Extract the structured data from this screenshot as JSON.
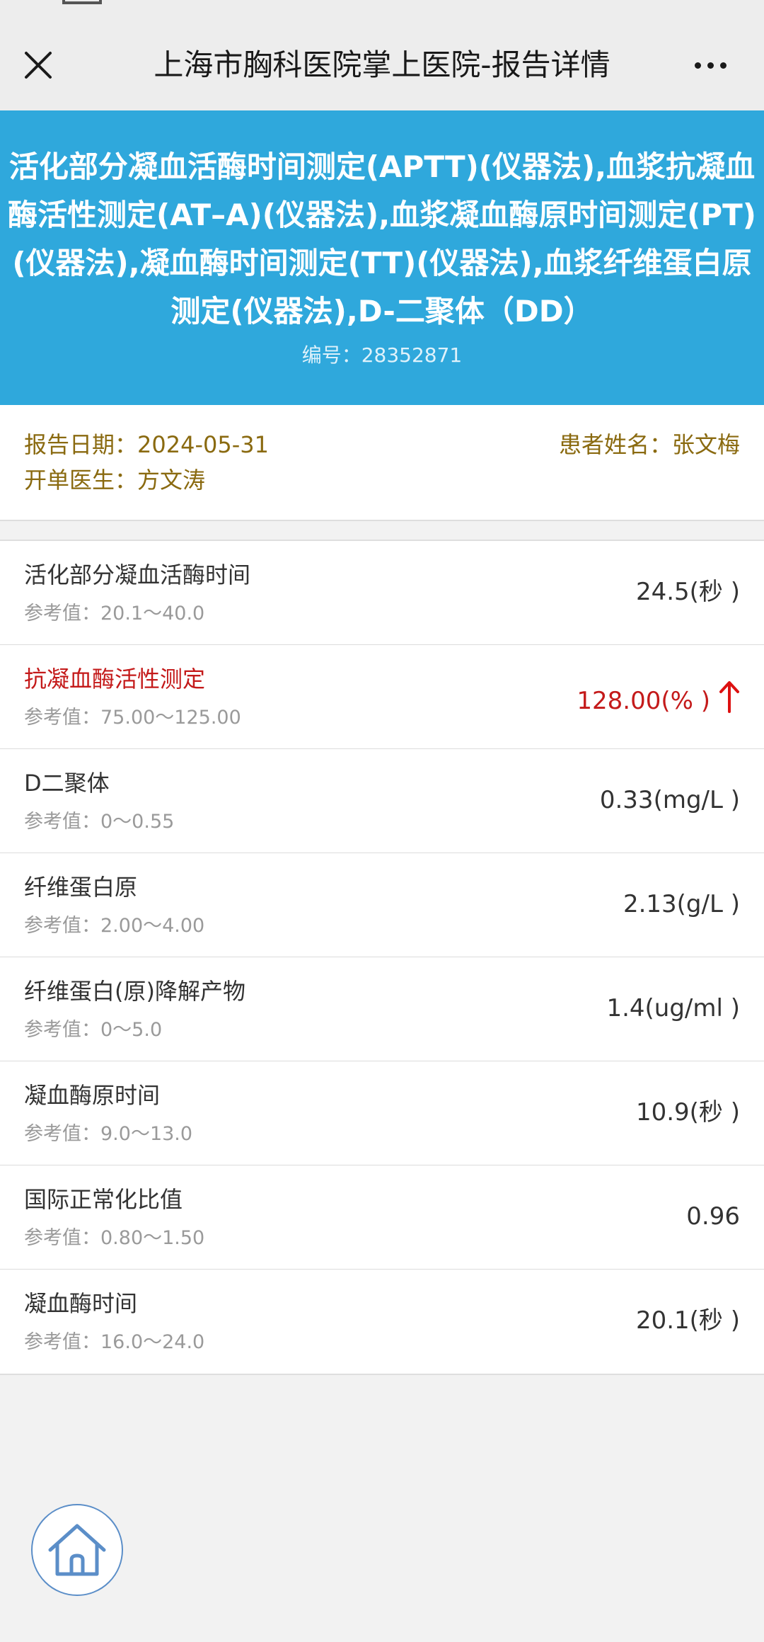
{
  "nav": {
    "title": "上海市胸科医院掌上医院-报告详情",
    "close_icon": "close-icon",
    "more_icon": "more-icon"
  },
  "banner": {
    "title": "活化部分凝血活酶时间测定(APTT)(仪器法),血浆抗凝血酶活性测定(AT–A)(仪器法),血浆凝血酶原时间测定(PT)(仪器法),凝血酶时间测定(TT)(仪器法),血浆纤维蛋白原测定(仪器法),D-二聚体（DD）",
    "serial": "编号：28352871"
  },
  "info": {
    "report_date": "报告日期：2024-05-31",
    "patient_name": "患者姓名：张文梅",
    "doctor": "开单医生：方文涛"
  },
  "results": [
    {
      "name": "活化部分凝血活酶时间",
      "ref": "参考值：20.1～40.0",
      "value": "24.5(秒 )",
      "abnormal": false
    },
    {
      "name": "抗凝血酶活性测定",
      "ref": "参考值：75.00～125.00",
      "value": "128.00(% )",
      "abnormal": true,
      "flag": "high",
      "flag_icon": "up-arrow-icon"
    },
    {
      "name": "D二聚体",
      "ref": "参考值：0～0.55",
      "value": "0.33(mg/L )",
      "abnormal": false
    },
    {
      "name": "纤维蛋白原",
      "ref": "参考值：2.00～4.00",
      "value": "2.13(g/L )",
      "abnormal": false
    },
    {
      "name": "纤维蛋白(原)降解产物",
      "ref": "参考值：0～5.0",
      "value": "1.4(ug/ml )",
      "abnormal": false
    },
    {
      "name": "凝血酶原时间",
      "ref": "参考值：9.0～13.0",
      "value": "10.9(秒 )",
      "abnormal": false
    },
    {
      "name": "国际正常化比值",
      "ref": "参考值：0.80～1.50",
      "value": "0.96",
      "abnormal": false
    },
    {
      "name": "凝血酶时间",
      "ref": "参考值：16.0～24.0",
      "value": "20.1(秒 )",
      "abnormal": false
    }
  ],
  "colors": {
    "banner": "#2fa8dc",
    "info_text": "#8a6a10",
    "abnormal": "#c41a1a",
    "home_border": "#5b8ec8"
  },
  "home_icon": "home-icon"
}
